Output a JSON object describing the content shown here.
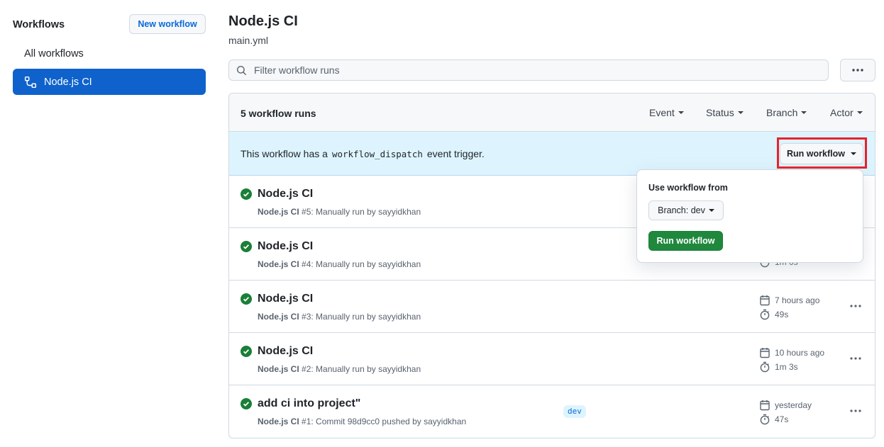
{
  "sidebar": {
    "title": "Workflows",
    "new_button": "New workflow",
    "items": [
      {
        "label": "All workflows"
      },
      {
        "label": "Node.js CI"
      }
    ]
  },
  "header": {
    "title": "Node.js CI",
    "subtitle": "main.yml"
  },
  "search": {
    "placeholder": "Filter workflow runs"
  },
  "runs": {
    "count_label": "5 workflow runs",
    "filters": [
      "Event",
      "Status",
      "Branch",
      "Actor"
    ],
    "dispatch": {
      "prefix": "This workflow has a",
      "code": "workflow_dispatch",
      "suffix": "event trigger.",
      "button": "Run workflow"
    },
    "rows": [
      {
        "title": "Node.js CI",
        "wf": "Node.js CI",
        "detail": "#5: Manually run by sayyidkhan",
        "time": "",
        "duration": ""
      },
      {
        "title": "Node.js CI",
        "wf": "Node.js CI",
        "detail": "#4: Manually run by sayyidkhan",
        "time": "",
        "duration": "1m 0s"
      },
      {
        "title": "Node.js CI",
        "wf": "Node.js CI",
        "detail": "#3: Manually run by sayyidkhan",
        "time": "7 hours ago",
        "duration": "49s"
      },
      {
        "title": "Node.js CI",
        "wf": "Node.js CI",
        "detail": "#2: Manually run by sayyidkhan",
        "time": "10 hours ago",
        "duration": "1m 3s"
      },
      {
        "title": "add ci into project\"",
        "wf": "Node.js CI",
        "detail": "#1: Commit 98d9cc0 pushed by sayyidkhan",
        "time": "yesterday",
        "duration": "47s",
        "branch": "dev"
      }
    ]
  },
  "dropdown": {
    "label": "Use workflow from",
    "branch_button": "Branch: dev",
    "run_button": "Run workflow"
  },
  "colors": {
    "accent": "#0969da",
    "sidebar_active": "#0f62cc",
    "success": "#1a7f37",
    "run_button": "#1f883d",
    "dispatch_bg": "#ddf4ff",
    "highlight": "#e8222a"
  }
}
